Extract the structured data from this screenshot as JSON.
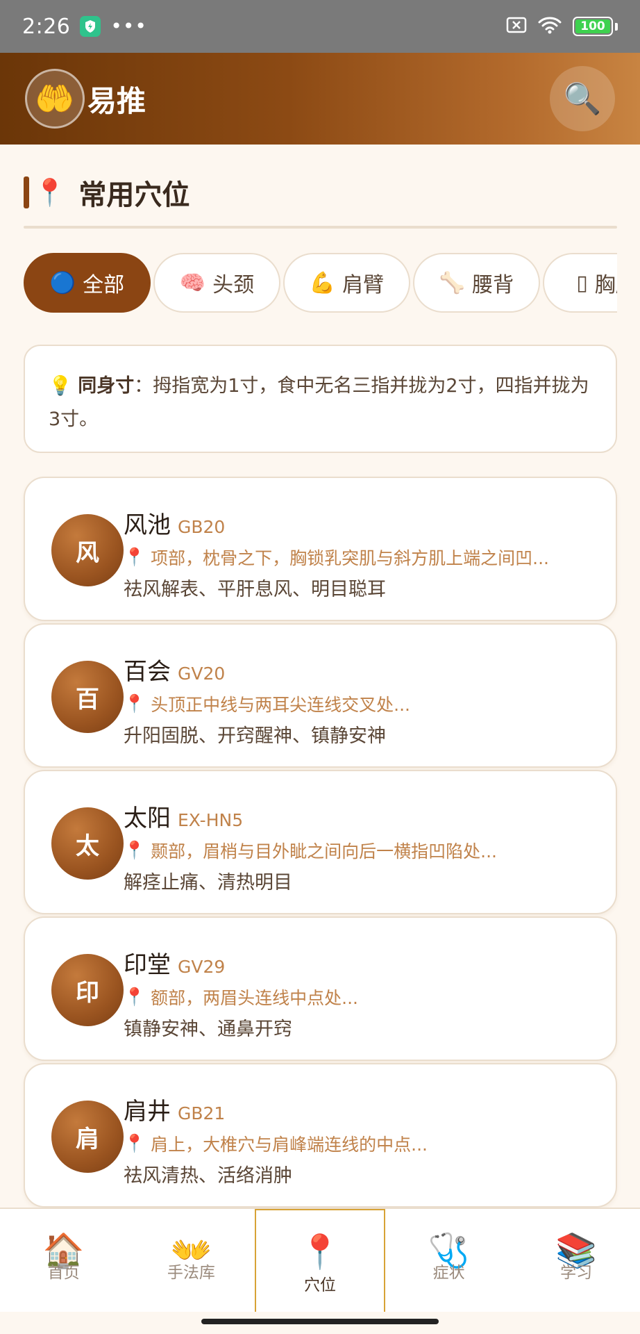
{
  "status_bar": {
    "time": "2:26",
    "dots": "•••",
    "battery": "100"
  },
  "header": {
    "logo_emoji": "🤲",
    "title": "易推",
    "search_emoji": "🔍"
  },
  "section": {
    "pin_emoji": "📍",
    "title": "常用穴位"
  },
  "categories": [
    {
      "icon": "🔵",
      "label": "全部",
      "active": true
    },
    {
      "icon": "🧠",
      "label": "头颈",
      "active": false
    },
    {
      "icon": "💪",
      "label": "肩臂",
      "active": false
    },
    {
      "icon": "🦴",
      "label": "腰背",
      "active": false
    },
    {
      "icon": "▯",
      "label": "胸腹",
      "active": false
    }
  ],
  "tip": {
    "icon": "💡",
    "bold": "同身寸",
    "text": "：拇指宽为1寸，食中无名三指并拢为2寸，四指并拢为3寸。"
  },
  "points": [
    {
      "initial": "风",
      "name": "风池",
      "code": "GB20",
      "location": "项部，枕骨之下，胸锁乳突肌与斜方肌上端之间凹...",
      "effect": "祛风解表、平肝息风、明目聪耳"
    },
    {
      "initial": "百",
      "name": "百会",
      "code": "GV20",
      "location": "头顶正中线与两耳尖连线交叉处...",
      "effect": "升阳固脱、开窍醒神、镇静安神"
    },
    {
      "initial": "太",
      "name": "太阳",
      "code": "EX-HN5",
      "location": "颞部，眉梢与目外眦之间向后一横指凹陷处...",
      "effect": "解痉止痛、清热明目"
    },
    {
      "initial": "印",
      "name": "印堂",
      "code": "GV29",
      "location": "额部，两眉头连线中点处...",
      "effect": "镇静安神、通鼻开窍"
    },
    {
      "initial": "肩",
      "name": "肩井",
      "code": "GB21",
      "location": "肩上，大椎穴与肩峰端连线的中点...",
      "effect": "祛风清热、活络消肿"
    }
  ],
  "pin_emoji": "📍",
  "nav": [
    {
      "icon": "🏠",
      "label": "首页",
      "active": false
    },
    {
      "icon": "👐",
      "label": "手法库",
      "active": false
    },
    {
      "icon": "📍",
      "label": "穴位",
      "active": true
    },
    {
      "icon": "🩺",
      "label": "症状",
      "active": false
    },
    {
      "icon": "📚",
      "label": "学习",
      "active": false
    }
  ]
}
